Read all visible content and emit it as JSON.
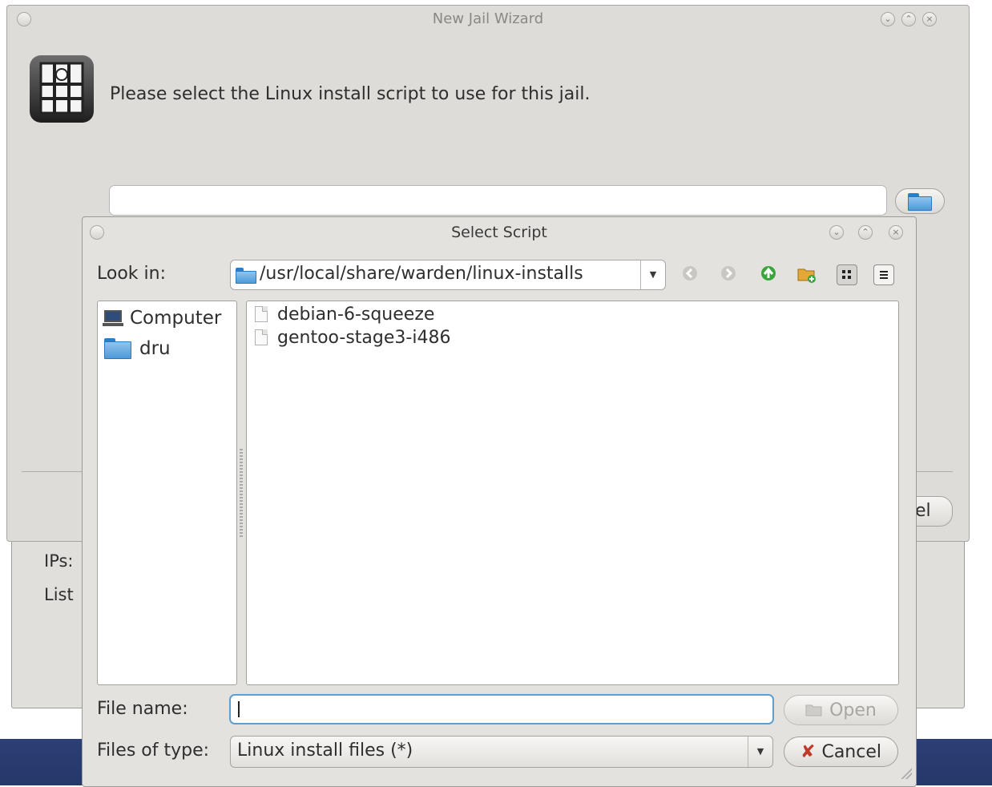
{
  "wizard": {
    "title": "New Jail Wizard",
    "prompt": "Please select the Linux install script to use for this jail.",
    "script_path_value": "",
    "cancel_label_partial": "el"
  },
  "background": {
    "ips_label": "IPs:",
    "list_label_partial": "List"
  },
  "dialog": {
    "title": "Select Script",
    "look_in_label": "Look in:",
    "current_path": "/usr/local/share/warden/linux-installs",
    "sidebar": [
      {
        "label": "Computer",
        "icon": "computer-icon"
      },
      {
        "label": "dru",
        "icon": "folder-icon"
      }
    ],
    "files": [
      {
        "name": "debian-6-squeeze",
        "icon": "file-icon"
      },
      {
        "name": "gentoo-stage3-i486",
        "icon": "file-icon"
      }
    ],
    "file_name_label": "File name:",
    "file_name_value": "",
    "files_of_type_label": "Files of type:",
    "files_of_type_value": "Linux install files (*)",
    "open_label": "Open",
    "cancel_label": "Cancel"
  },
  "colors": {
    "folder_blue": "#4d9ada",
    "focus_border": "#5d9fd3",
    "desktop_panel": "#2c3f75",
    "cancel_x_red": "#c0392b"
  }
}
